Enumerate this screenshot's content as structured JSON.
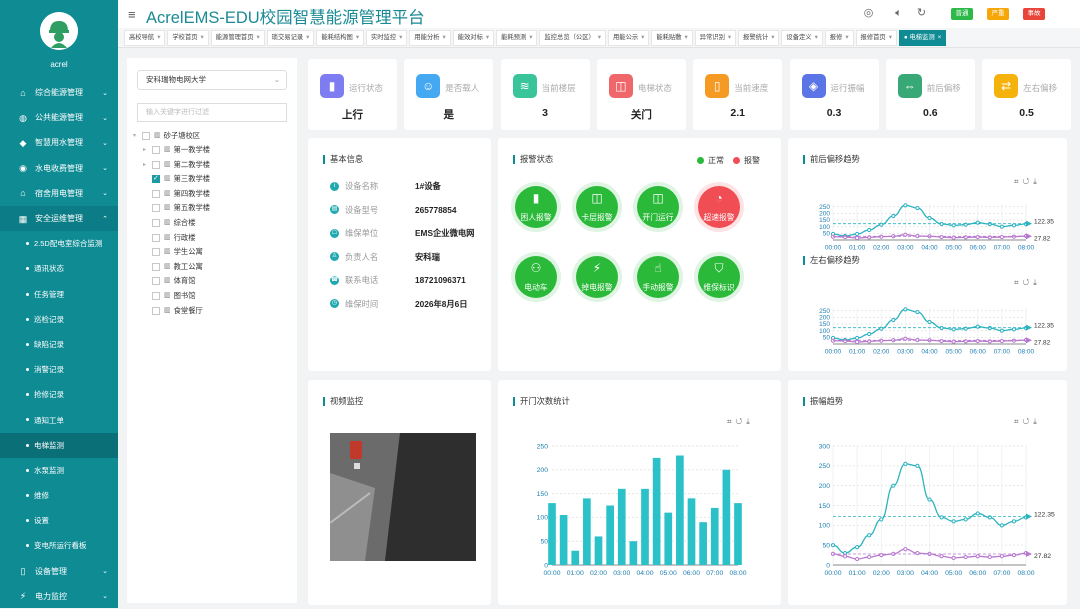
{
  "sidebar": {
    "user": "acrel",
    "menu": [
      {
        "label": "综合能源管理",
        "icon": "home-icon",
        "chev": "⌄"
      },
      {
        "label": "公共能源管理",
        "icon": "globe-icon",
        "chev": "⌄"
      },
      {
        "label": "智慧用水管理",
        "icon": "water-drop-icon",
        "chev": "⌄"
      },
      {
        "label": "水电收费管理",
        "icon": "coin-icon",
        "chev": "⌄"
      },
      {
        "label": "宿舍用电管理",
        "icon": "house-icon",
        "chev": "⌄"
      },
      {
        "label": "安全运维管理",
        "icon": "grid-icon",
        "chev": "⌃"
      },
      {
        "label": "2.5D配电室综合监测"
      },
      {
        "label": "通讯状态"
      },
      {
        "label": "任务管理"
      },
      {
        "label": "巡检记录"
      },
      {
        "label": "缺陷记录"
      },
      {
        "label": "消警记录"
      },
      {
        "label": "抢修记录"
      },
      {
        "label": "通知工单"
      },
      {
        "label": "电梯监测"
      },
      {
        "label": "水泵监测"
      },
      {
        "label": "维修"
      },
      {
        "label": "设置"
      },
      {
        "label": "变电所运行看板"
      },
      {
        "label": "设备管理",
        "icon": "device-icon",
        "chev": "⌄"
      },
      {
        "label": "电力监控",
        "icon": "power-icon",
        "chev": "⌄"
      }
    ]
  },
  "header": {
    "title": "AcrelEMS-EDU校园智慧能源管理平台",
    "badges": [
      {
        "label": "普通",
        "color": "#2cb94a"
      },
      {
        "label": "严重",
        "color": "#f6a609"
      },
      {
        "label": "事故",
        "color": "#e8443a"
      }
    ]
  },
  "tabs": [
    "高校导航",
    "学校首页",
    "能源管理首页",
    "琐交易记录",
    "能耗结构图",
    "实时监控",
    "用能分析",
    "能效对标",
    "能耗预测",
    "监控总览（公区）",
    "用能公示",
    "能耗贴敷",
    "异常识别",
    "报警统计",
    "设备定义",
    "报修",
    "报修首页",
    "电梯监测"
  ],
  "tree": {
    "select": "安科瑞物电网大学",
    "search_placeholder": "输入关键字进行过滤",
    "root": "砂子塘校区",
    "nodes": [
      "第一教学楼",
      "第二教学楼",
      "第三教学楼",
      "第四教学楼",
      "第五教学楼",
      "综合楼",
      "行政楼",
      "学生公寓",
      "教工公寓",
      "体育馆",
      "图书馆",
      "食堂餐厅"
    ],
    "checked": "第三教学楼"
  },
  "stats": [
    {
      "label": "运行状态",
      "value": "上行",
      "color": "#7d7cf0",
      "icon": "elevator-icon"
    },
    {
      "label": "是否载人",
      "value": "是",
      "color": "#44a8f2",
      "icon": "person-icon"
    },
    {
      "label": "当前楼层",
      "value": "3",
      "color": "#39c49a",
      "icon": "layers-icon"
    },
    {
      "label": "电梯状态",
      "value": "关门",
      "color": "#f0676b",
      "icon": "door-icon"
    },
    {
      "label": "当前速度",
      "value": "2.1",
      "color": "#f59a23",
      "icon": "speed-icon"
    },
    {
      "label": "运行振幅",
      "value": "0.3",
      "color": "#5b74e6",
      "icon": "vibration-icon"
    },
    {
      "label": "前后偏移",
      "value": "0.6",
      "color": "#39a877",
      "icon": "offset-icon"
    },
    {
      "label": "左右偏移",
      "value": "0.5",
      "color": "#f5b20a",
      "icon": "lr-offset-icon"
    }
  ],
  "basic": {
    "title": "基本信息",
    "rows": [
      {
        "k": "设备名称",
        "v": "1#设备"
      },
      {
        "k": "设备型号",
        "v": "265778854"
      },
      {
        "k": "维保单位",
        "v": "EMS企业微电网"
      },
      {
        "k": "负责人名",
        "v": "安科瑞"
      },
      {
        "k": "联系电话",
        "v": "18721096371"
      },
      {
        "k": "维保时间",
        "v": "2026年8月6日"
      }
    ]
  },
  "alarm": {
    "title": "报警状态",
    "legend_normal": "正常",
    "legend_alarm": "报警",
    "normal_color": "#2bb93a",
    "alarm_color": "#f04d55",
    "items": [
      {
        "label": "困人报警",
        "alarm": false
      },
      {
        "label": "卡层报警",
        "alarm": false
      },
      {
        "label": "开门运行",
        "alarm": false
      },
      {
        "label": "超速报警",
        "alarm": true
      },
      {
        "label": "电动车",
        "alarm": false
      },
      {
        "label": "掉电报警",
        "alarm": false
      },
      {
        "label": "手动报警",
        "alarm": false
      },
      {
        "label": "维保标识",
        "alarm": false
      }
    ]
  },
  "video": {
    "title": "视频监控"
  },
  "charts": {
    "fb": {
      "title": "前后偏移趋势"
    },
    "lr": {
      "title": "左右偏移趋势"
    },
    "door": {
      "title": "开门次数统计"
    },
    "amp": {
      "title": "振幅趋势"
    }
  },
  "chart_data": [
    {
      "type": "line",
      "title": "前后偏移趋势",
      "x": [
        "00:00",
        "01:00",
        "02:00",
        "03:00",
        "04:00",
        "05:00",
        "06:00",
        "07:00",
        "08:00"
      ],
      "y_ticks": [
        50,
        100,
        150,
        200,
        250
      ],
      "ylim": [
        0,
        270
      ],
      "series": [
        {
          "color": "#2bb3bf",
          "values": [
            45,
            30,
            45,
            75,
            115,
            180,
            260,
            240,
            165,
            120,
            110,
            115,
            130,
            120,
            100,
            110,
            120
          ]
        },
        {
          "color": "#b878d0",
          "values": [
            25,
            22,
            15,
            20,
            25,
            28,
            40,
            30,
            28,
            22,
            18,
            20,
            22,
            20,
            22,
            25,
            30
          ]
        }
      ],
      "mark_lines": [
        {
          "value": 122.35,
          "label": "122.35"
        },
        {
          "value": 27.82,
          "label": "27.82"
        }
      ]
    },
    {
      "type": "line",
      "title": "左右偏移趋势",
      "x": [
        "00:00",
        "01:00",
        "02:00",
        "03:00",
        "04:00",
        "05:00",
        "06:00",
        "07:00",
        "08:00"
      ],
      "y_ticks": [
        50,
        100,
        150,
        200,
        250
      ],
      "ylim": [
        0,
        270
      ],
      "series": [
        {
          "color": "#2bb3bf",
          "values": [
            45,
            30,
            45,
            75,
            115,
            180,
            260,
            240,
            165,
            120,
            110,
            115,
            130,
            120,
            100,
            110,
            120
          ]
        },
        {
          "color": "#b878d0",
          "values": [
            25,
            22,
            15,
            20,
            25,
            28,
            40,
            30,
            28,
            22,
            18,
            20,
            22,
            20,
            22,
            25,
            30
          ]
        }
      ],
      "mark_lines": [
        {
          "value": 122.35,
          "label": "122.35"
        },
        {
          "value": 27.82,
          "label": "27.82"
        }
      ]
    },
    {
      "type": "bar",
      "title": "开门次数统计",
      "x": [
        "00:00",
        "01:00",
        "02:00",
        "03:00",
        "04:00",
        "05:00",
        "06:00",
        "07:00",
        "08:00"
      ],
      "y_ticks": [
        0,
        50,
        100,
        150,
        200,
        250
      ],
      "ylim": [
        0,
        250
      ],
      "color": "#2bc1c8",
      "values": [
        130,
        105,
        30,
        140,
        60,
        125,
        160,
        50,
        160,
        225,
        110,
        230,
        140,
        90,
        120,
        200,
        130
      ]
    },
    {
      "type": "line",
      "title": "振幅趋势",
      "x": [
        "00:00",
        "01:00",
        "02:00",
        "03:00",
        "04:00",
        "05:00",
        "06:00",
        "07:00",
        "08:00"
      ],
      "y_ticks": [
        0,
        50,
        100,
        150,
        200,
        250,
        300
      ],
      "ylim": [
        0,
        300
      ],
      "series": [
        {
          "color": "#2bb3bf",
          "values": [
            50,
            30,
            45,
            75,
            115,
            200,
            255,
            250,
            165,
            120,
            110,
            115,
            130,
            120,
            100,
            110,
            120
          ]
        },
        {
          "color": "#b878d0",
          "values": [
            28,
            22,
            15,
            20,
            25,
            28,
            40,
            30,
            28,
            22,
            18,
            20,
            22,
            20,
            22,
            25,
            30
          ]
        }
      ],
      "mark_lines": [
        {
          "value": 122.35,
          "label": "122.35"
        },
        {
          "value": 27.82,
          "label": "27.82"
        }
      ]
    }
  ]
}
